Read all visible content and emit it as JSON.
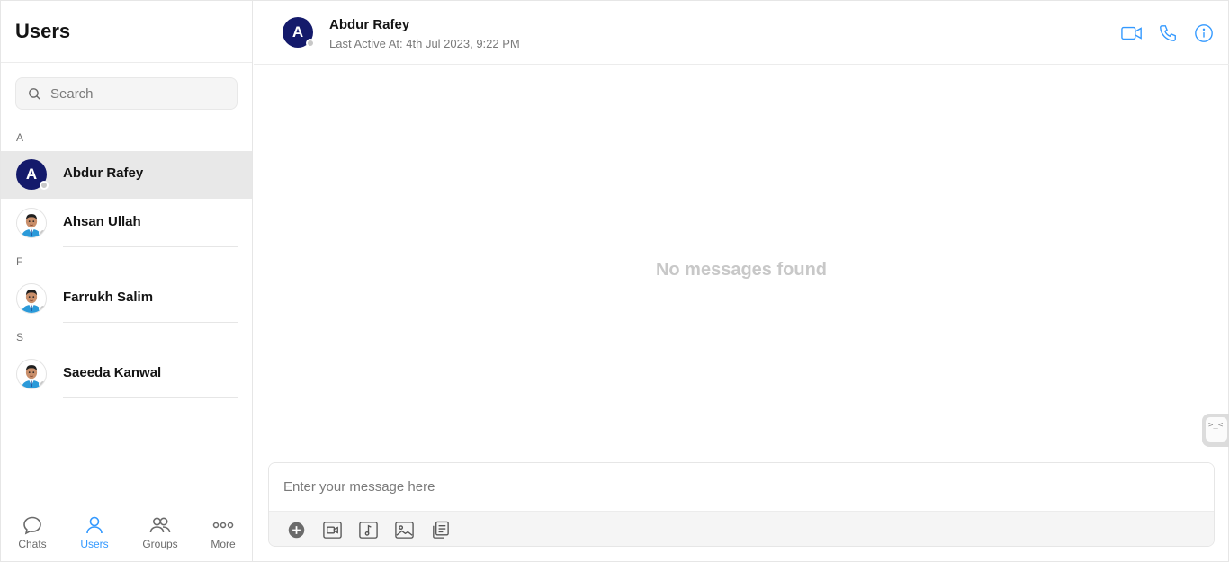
{
  "sidebar": {
    "title": "Users",
    "search_placeholder": "Search",
    "sections": [
      {
        "letter": "A"
      },
      {
        "letter": "F"
      },
      {
        "letter": "S"
      }
    ],
    "users": [
      {
        "name": "Abdur Rafey",
        "avatar_letter": "A",
        "active": true
      },
      {
        "name": "Ahsan Ullah"
      },
      {
        "name": "Farrukh Salim"
      },
      {
        "name": "Saeeda Kanwal"
      }
    ]
  },
  "bottom_nav": [
    {
      "label": "Chats",
      "icon": "chat-bubble-icon"
    },
    {
      "label": "Users",
      "icon": "user-icon",
      "active": true
    },
    {
      "label": "Groups",
      "icon": "groups-icon"
    },
    {
      "label": "More",
      "icon": "more-dots-icon"
    }
  ],
  "chat": {
    "name": "Abdur Rafey",
    "avatar_letter": "A",
    "status": "Last Active At: 4th Jul 2023, 9:22 PM",
    "empty_text": "No messages found",
    "composer_placeholder": "Enter your message here",
    "side_tab_text": ">_<"
  },
  "colors": {
    "accent": "#3399ff",
    "avatar_bg": "#141a6b",
    "active_row": "#e8e8e8",
    "empty_text": "#c8c8c8"
  }
}
